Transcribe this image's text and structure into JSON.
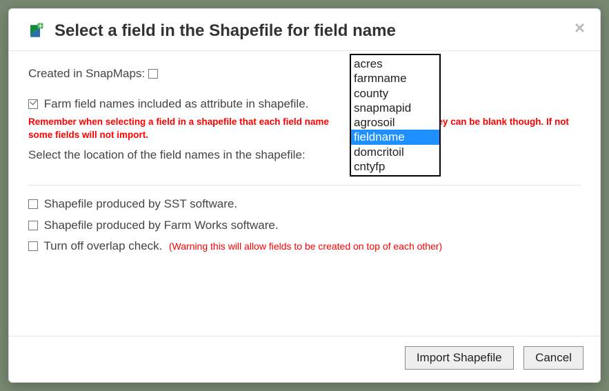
{
  "modal": {
    "title": "Select a field in the Shapefile for field name",
    "close_glyph": "×"
  },
  "body": {
    "created_label": "Created in SnapMaps:",
    "created_checked": false,
    "farmfield_label": "Farm field names included as attribute in shapefile.",
    "farmfield_checked": true,
    "warning_1a": "Remember when selecting a field in a shapefile that each field name",
    "warning_1b": "ey can be blank though. If not some fields will not import.",
    "select_location_label": "Select the location of the field names in the shapefile:",
    "sst_label": "Shapefile produced by SST software.",
    "sst_checked": false,
    "farmworks_label": "Shapefile produced by Farm Works software.",
    "farmworks_checked": false,
    "overlap_label": "Turn off overlap check.",
    "overlap_checked": false,
    "overlap_warning": "(Warning this will allow fields to be created on top of each other)"
  },
  "listbox": {
    "options": [
      "acres",
      "farmname",
      "county",
      "snapmapid",
      "agrosoil",
      "fieldname",
      "domcritoil",
      "cntyfp"
    ],
    "selected": "fieldname"
  },
  "footer": {
    "import_label": "Import Shapefile",
    "cancel_label": "Cancel"
  }
}
